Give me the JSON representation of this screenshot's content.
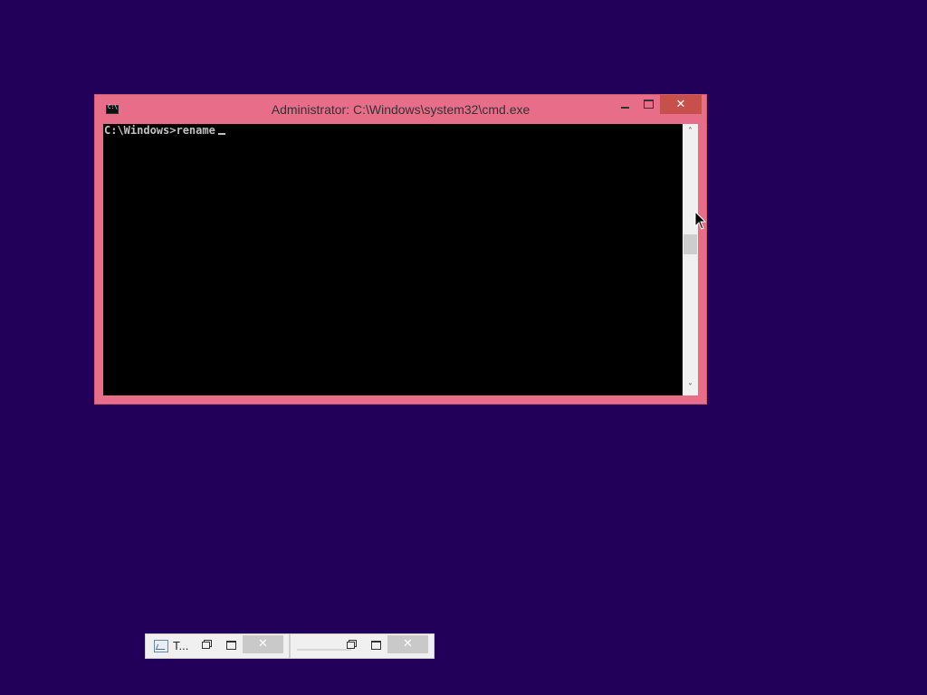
{
  "window": {
    "title": "Administrator: C:\\Windows\\system32\\cmd.exe",
    "minimize_icon": "minimize-icon",
    "maximize_icon": "maximize-icon",
    "close_label": "✕"
  },
  "console": {
    "prompt": "C:\\Windows>",
    "command": "rename"
  },
  "scrollbar": {
    "up_glyph": "˄",
    "down_glyph": "˅"
  },
  "minimized": [
    {
      "title": "T...",
      "close_label": "✕"
    },
    {
      "title": "",
      "close_label": "✕"
    }
  ],
  "colors": {
    "desktop": "#22005a",
    "window_frame": "#e86d88",
    "console_bg": "#000000",
    "console_text": "#c0c0c0",
    "close_button": "#c7504a"
  }
}
